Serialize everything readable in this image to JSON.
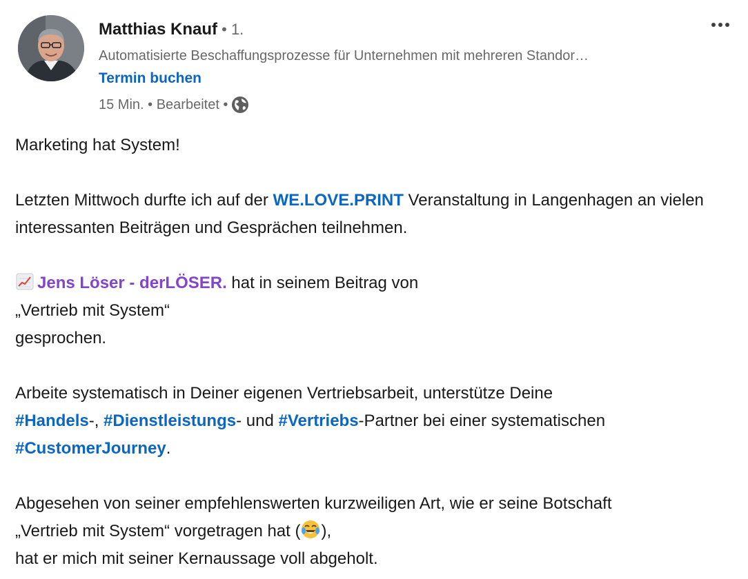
{
  "author": {
    "name": "Matthias Knauf",
    "degree": " • 1.",
    "headline": "Automatisierte Beschaffungsprozesse für Unternehmen mit mehreren Standor…",
    "cta_label": "Termin buchen",
    "time": "15 Min. • Bearbeitet • "
  },
  "icons": {
    "more": "more-options-icon",
    "visibility": "globe-icon",
    "chart": "chart-increasing-emoji",
    "laugh": "tears-of-joy-emoji"
  },
  "colors": {
    "link": "#0a66c2",
    "company_mention": "#8344cc",
    "secondary_text": "rgba(0,0,0,0.6)"
  },
  "post": {
    "p1": "Marketing hat System!",
    "p2_a": "Letzten Mittwoch durfte ich auf der ",
    "p2_mention": "WE.LOVE.PRINT",
    "p2_b": " Veranstaltung in Langenhagen an vielen interessanten Beiträgen und Gesprächen teilnehmen.",
    "p3_mention": "Jens Löser - derLÖSER.",
    "p3_a": " hat in seinem Beitrag von",
    "p3_b": "„Vertrieb mit System“",
    "p3_c": "gesprochen.",
    "p4_a": "Arbeite systematisch in Deiner eigenen Vertriebsarbeit, unterstütze Deine",
    "p4_tag1": "#Handels",
    "p4_b": "-, ",
    "p4_tag2": "#Dienstleistungs",
    "p4_c": "- und ",
    "p4_tag3": "#Vertriebs",
    "p4_d": "-Partner bei einer systematischen",
    "p4_tag4": "#CustomerJourney",
    "p4_e": ".",
    "p5_a": "Abgesehen von seiner empfehlenswerten kurzweiligen Art, wie er seine Botschaft",
    "p5_b": "„Vertrieb mit System“ vorgetragen hat (",
    "p5_c": "),",
    "p5_d": "hat er mich mit seiner Kernaussage voll abgeholt."
  }
}
